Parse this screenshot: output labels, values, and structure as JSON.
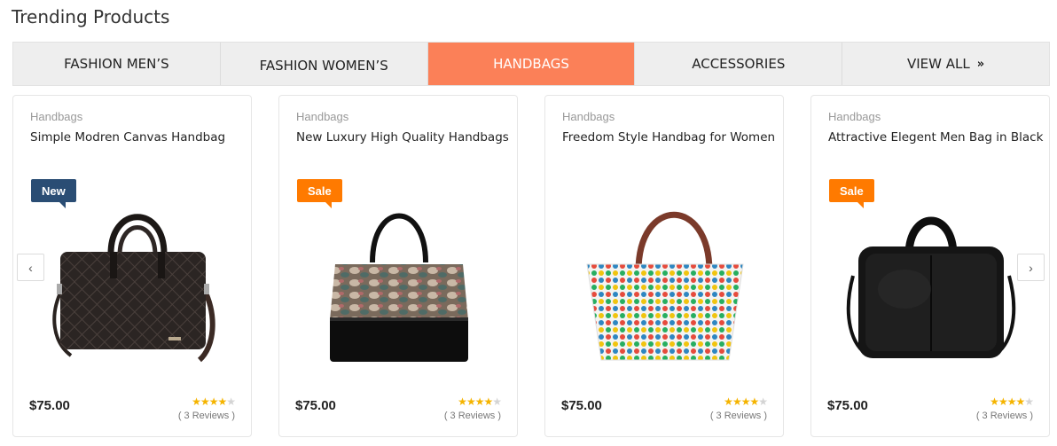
{
  "section": {
    "title": "Trending Products"
  },
  "colors": {
    "accent": "#fb8058",
    "new_badge": "#2a4d74",
    "sale_badge": "#ff7a00"
  },
  "tabs": [
    {
      "label": "FASHION MEN’S",
      "active": false
    },
    {
      "label": "FASHION WOMEN’S",
      "active": false
    },
    {
      "label": "HANDBAGS",
      "active": true
    },
    {
      "label": "ACCESSORIES",
      "active": false
    },
    {
      "label": "VIEW ALL",
      "active": false,
      "icon": "double-chevron-right-icon"
    }
  ],
  "carousel": {
    "prev_icon": "chevron-left-icon",
    "next_icon": "chevron-right-icon"
  },
  "products": [
    {
      "category": "Handbags",
      "name": "Simple Modren Canvas Handbag",
      "badge": "New",
      "price": "$75.00",
      "rating": 4,
      "rating_max": 5,
      "reviews": "( 3 Reviews )",
      "image": "dark-quilted-laptop-bag-image"
    },
    {
      "category": "Handbags",
      "name": "New Luxury High Quality Handbags",
      "badge": "Sale",
      "price": "$75.00",
      "rating": 4,
      "rating_max": 5,
      "reviews": "( 3 Reviews )",
      "image": "snakeskin-top-handle-handbag-image"
    },
    {
      "category": "Handbags",
      "name": "Freedom Style Handbag for Women",
      "badge": "",
      "price": "$75.00",
      "rating": 4,
      "rating_max": 5,
      "reviews": "( 3 Reviews )",
      "image": "polka-dot-tote-bag-image"
    },
    {
      "category": "Handbags",
      "name": "Attractive Elegent Men Bag in Black",
      "badge": "Sale",
      "price": "$75.00",
      "rating": 4,
      "rating_max": 5,
      "reviews": "( 3 Reviews )",
      "image": "black-leather-briefcase-bag-image"
    }
  ]
}
